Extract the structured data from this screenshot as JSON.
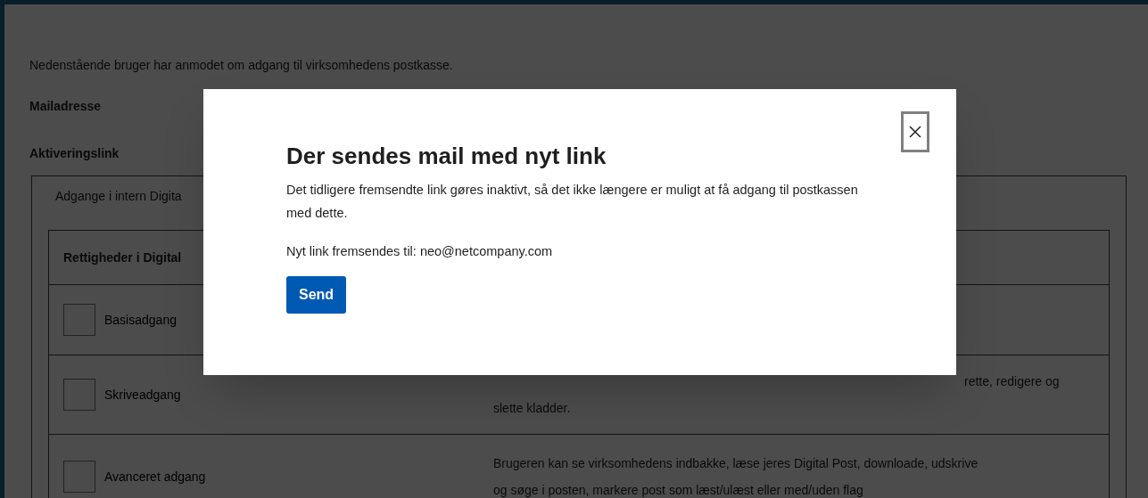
{
  "page": {
    "intro": "Nedenstående bruger har anmodet om adgang til virksomhedens postkasse.",
    "fields": [
      {
        "label": "Mailadresse"
      },
      {
        "label": "Aktiveringslink"
      }
    ],
    "fieldset": {
      "legend": "Adgange i intern Digita",
      "table": {
        "header": "Rettigheder i Digital",
        "rows": [
          {
            "label": "Basisadgang",
            "checked": false,
            "disabled": true,
            "description_lines": []
          },
          {
            "label": "Skriveadgang",
            "checked": false,
            "disabled": true,
            "description_lines": [
              "rette, redigere og",
              "slette kladder."
            ]
          },
          {
            "label": "Avanceret adgang",
            "checked": false,
            "disabled": true,
            "description_lines": [
              "Brugeren kan se virksomhedens indbakke, læse jeres Digital Post, downloade, udskrive",
              "og søge i posten, markere post som læst/ulæst eller med/uden flag"
            ]
          }
        ]
      }
    }
  },
  "modal": {
    "title": "Der sendes mail med nyt link",
    "body": "Det tidligere fremsendte link gøres inaktivt, så det ikke længere er muligt at få adgang til postkassen med dette.",
    "recipient": "Nyt link fremsendes til: neo@netcompany.com",
    "button": "Send"
  }
}
